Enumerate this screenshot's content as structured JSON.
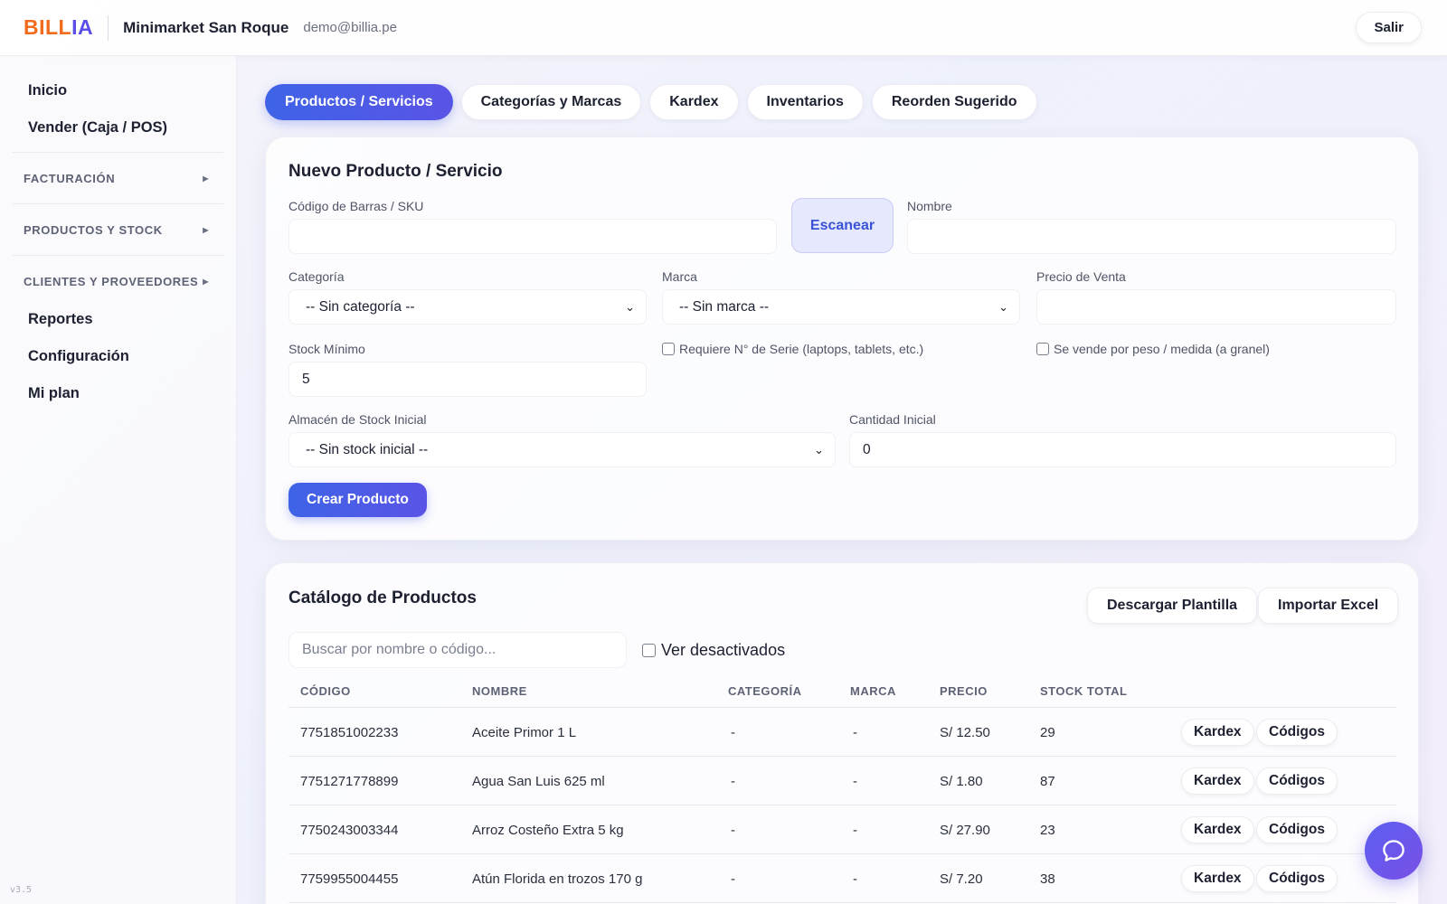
{
  "header": {
    "logo_part1": "BILL",
    "logo_part2": "IA",
    "shop_name": "Minimarket San Roque",
    "user_email": "demo@billia.pe",
    "logout_label": "Salir"
  },
  "sidebar": {
    "top_links": [
      "Inicio",
      "Vender (Caja / POS)"
    ],
    "groups": [
      "FACTURACIÓN",
      "PRODUCTOS Y STOCK",
      "CLIENTES Y PROVEEDORES"
    ],
    "bottom_links": [
      "Reportes",
      "Configuración",
      "Mi plan"
    ],
    "version": "v3.5"
  },
  "tabs": [
    {
      "label": "Productos / Servicios",
      "active": true
    },
    {
      "label": "Categorías y Marcas",
      "active": false
    },
    {
      "label": "Kardex",
      "active": false
    },
    {
      "label": "Inventarios",
      "active": false
    },
    {
      "label": "Reorden Sugerido",
      "active": false
    }
  ],
  "form": {
    "title": "Nuevo Producto / Servicio",
    "barcode_label": "Código de Barras / SKU",
    "barcode_value": "",
    "scan_label": "Escanear",
    "name_label": "Nombre",
    "name_value": "",
    "category_label": "Categoría",
    "category_value": "-- Sin categoría --",
    "brand_label": "Marca",
    "brand_value": "-- Sin marca --",
    "price_label": "Precio de Venta",
    "price_value": "",
    "min_stock_label": "Stock Mínimo",
    "min_stock_value": "5",
    "serial_label": "Requiere N° de Serie (laptops, tablets, etc.)",
    "bulk_label": "Se vende por peso / medida (a granel)",
    "warehouse_label": "Almacén de Stock Inicial",
    "warehouse_value": "-- Sin stock inicial --",
    "initial_qty_label": "Cantidad Inicial",
    "initial_qty_value": "0",
    "create_label": "Crear Producto"
  },
  "catalog": {
    "title": "Catálogo de Productos",
    "download_label": "Descargar Plantilla",
    "import_label": "Importar Excel",
    "search_placeholder": "Buscar por nombre o código...",
    "show_inactive_label": "Ver desactivados",
    "columns": [
      "CÓDIGO",
      "NOMBRE",
      "CATEGORÍA",
      "MARCA",
      "PRECIO",
      "STOCK TOTAL"
    ],
    "action_kardex": "Kardex",
    "action_codes": "Códigos",
    "rows": [
      {
        "code": "7751851002233",
        "name": "Aceite Primor 1 L",
        "category": "-",
        "brand": "-",
        "price": "S/ 12.50",
        "stock": "29"
      },
      {
        "code": "7751271778899",
        "name": "Agua San Luis 625 ml",
        "category": "-",
        "brand": "-",
        "price": "S/ 1.80",
        "stock": "87"
      },
      {
        "code": "7750243003344",
        "name": "Arroz Costeño Extra 5 kg",
        "category": "-",
        "brand": "-",
        "price": "S/ 27.90",
        "stock": "23"
      },
      {
        "code": "7759955004455",
        "name": "Atún Florida en trozos 170 g",
        "category": "-",
        "brand": "-",
        "price": "S/ 7.20",
        "stock": "38"
      }
    ]
  },
  "icons": {
    "chat": "chat-bubble-icon",
    "chevron": "chevron-right-icon",
    "select": "chevron-down-icon"
  },
  "colors": {
    "primary": "#3e63e6",
    "logo_orange": "#f26b1d",
    "logo_purple": "#5b4ee8"
  }
}
